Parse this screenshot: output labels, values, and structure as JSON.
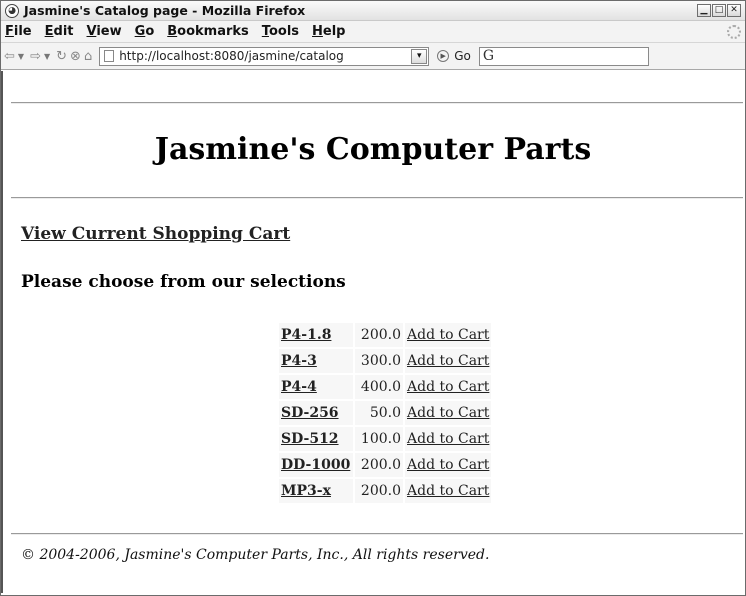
{
  "window": {
    "title": "Jasmine's Catalog page - Mozilla Firefox",
    "controls": [
      "minimize-icon",
      "maximize-icon",
      "close-icon"
    ]
  },
  "menu": [
    {
      "accel": "F",
      "rest": "ile"
    },
    {
      "accel": "E",
      "rest": "dit"
    },
    {
      "accel": "V",
      "rest": "iew"
    },
    {
      "accel": "G",
      "rest": "o"
    },
    {
      "accel": "B",
      "rest": "ookmarks"
    },
    {
      "accel": "T",
      "rest": "ools"
    },
    {
      "accel": "H",
      "rest": "elp"
    }
  ],
  "nav": {
    "url": "http://localhost:8080/jasmine/catalog",
    "go_label": "Go",
    "search_value": ""
  },
  "page": {
    "heading": "Jasmine's Computer Parts",
    "cart_link": "View Current Shopping Cart",
    "subheading": "Please choose from our selections",
    "products": [
      {
        "name": "P4-1.8",
        "price": "200.0",
        "action": "Add to Cart"
      },
      {
        "name": "P4-3",
        "price": "300.0",
        "action": "Add to Cart"
      },
      {
        "name": "P4-4",
        "price": "400.0",
        "action": "Add to Cart"
      },
      {
        "name": "SD-256",
        "price": "50.0",
        "action": "Add to Cart"
      },
      {
        "name": "SD-512",
        "price": "100.0",
        "action": "Add to Cart"
      },
      {
        "name": "DD-1000",
        "price": "200.0",
        "action": "Add to Cart"
      },
      {
        "name": "MP3-x",
        "price": "200.0",
        "action": "Add to Cart"
      }
    ],
    "footer": "© 2004-2006, Jasmine's Computer Parts, Inc., All rights reserved."
  }
}
